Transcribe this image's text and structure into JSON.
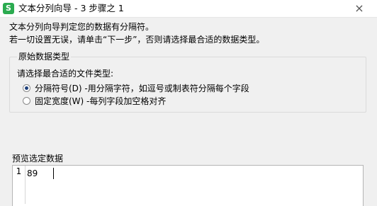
{
  "window": {
    "icon_glyph": "S",
    "title": "文本分列向导 - 3 步骤之 1",
    "close_glyph": "×"
  },
  "intro": {
    "line1": "文本分列向导判定您的数据有分隔符。",
    "line2": "若一切设置无误，请单击“下一步”，否则请选择最合适的数据类型。"
  },
  "data_type_group": {
    "legend": "原始数据类型",
    "prompt": "请选择最合适的文件类型:",
    "options": [
      {
        "label": "分隔符号(D) -用分隔字符，如逗号或制表符分隔每个字段",
        "checked": true
      },
      {
        "label": "固定宽度(W) -每列字段加空格对齐",
        "checked": false
      }
    ]
  },
  "preview": {
    "label": "预览选定数据",
    "rows": [
      {
        "num": "1",
        "value": "89"
      }
    ]
  },
  "colors": {
    "app_icon": "#2bab50",
    "radio_dot": "#1d3f7a"
  }
}
